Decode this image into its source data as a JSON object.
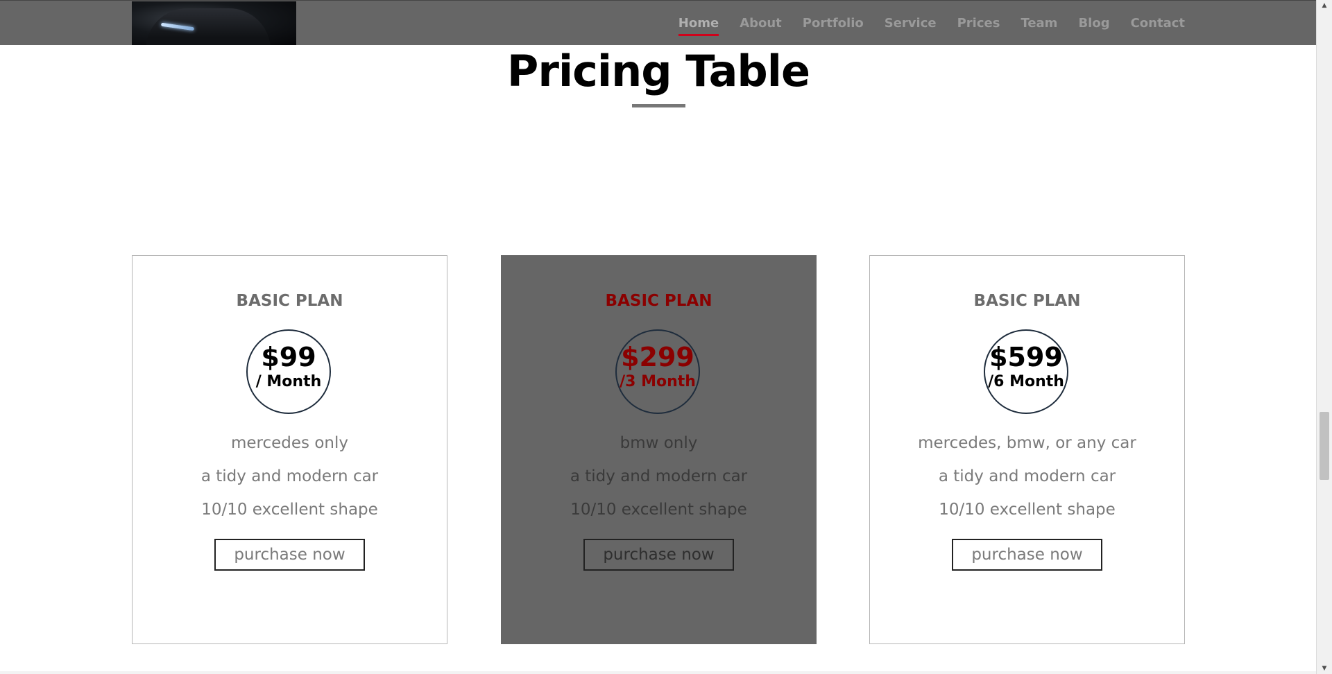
{
  "nav": {
    "items": [
      {
        "label": "Home",
        "active": true
      },
      {
        "label": "About"
      },
      {
        "label": "Portfolio"
      },
      {
        "label": "Service"
      },
      {
        "label": "Prices"
      },
      {
        "label": "Team"
      },
      {
        "label": "Blog"
      },
      {
        "label": "Contact"
      }
    ]
  },
  "section": {
    "title": "Pricing Table"
  },
  "plans": [
    {
      "name": "BASIC PLAN",
      "price": "$99",
      "period": "/ Month",
      "features": [
        "mercedes only",
        "a tidy and modern car",
        "10/10 excellent shape"
      ],
      "button": "purchase now"
    },
    {
      "name": "BASIC PLAN",
      "price": "$299",
      "period": "/3 Month",
      "features": [
        "bmw only",
        "a tidy and modern car",
        "10/10 excellent shape"
      ],
      "button": "purchase now"
    },
    {
      "name": "BASIC PLAN",
      "price": "$599",
      "period": "/6 Month",
      "features": [
        "mercedes, bmw, or any car",
        "a tidy and modern car",
        "10/10 excellent shape"
      ],
      "button": "purchase now"
    }
  ],
  "colors": {
    "navbar": "#666666",
    "active_underline": "#d0021b",
    "featured_accent": "#8b0000",
    "featured_card": "#666666"
  },
  "scrollbar": {
    "up_icon": "triangle-up-icon",
    "down_icon": "triangle-down-icon"
  }
}
